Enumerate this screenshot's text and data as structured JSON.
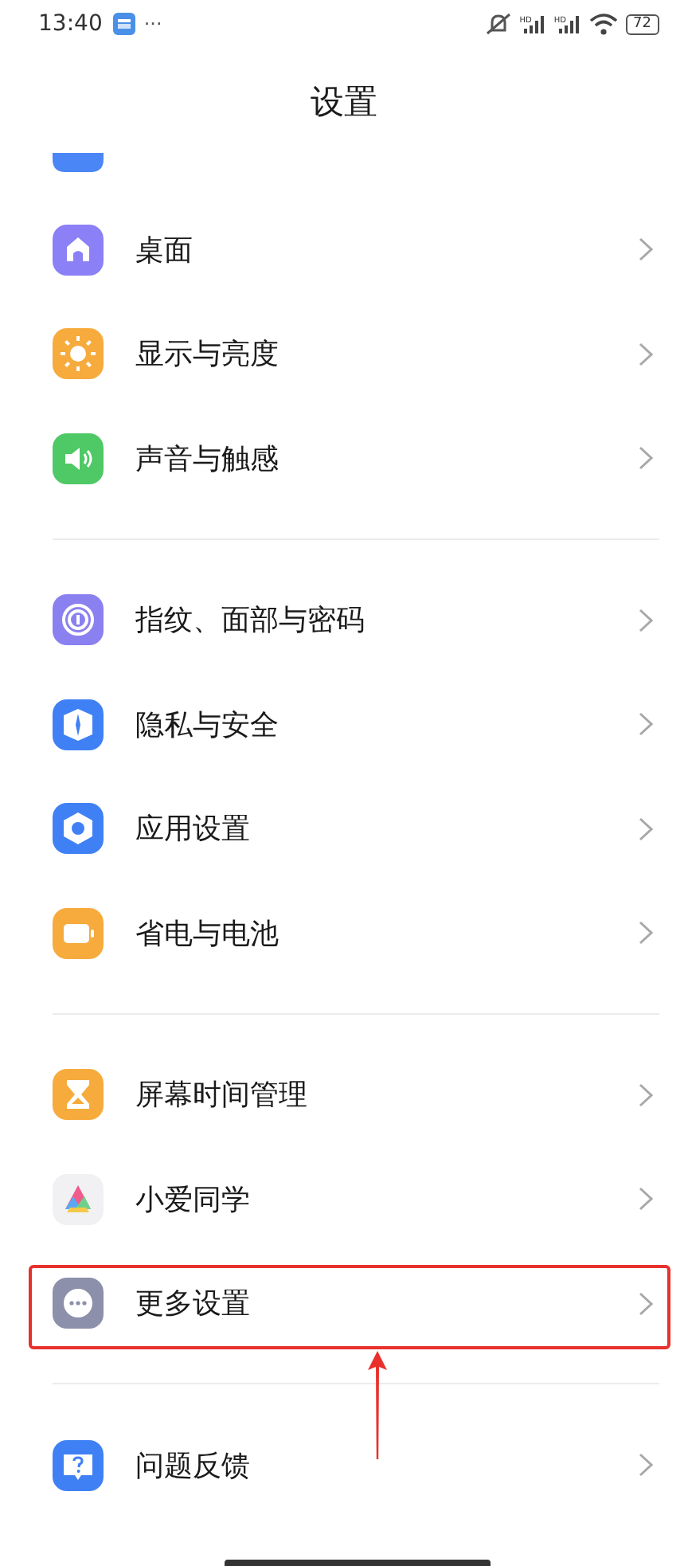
{
  "status_bar": {
    "time": "13:40",
    "more": "···",
    "signal_labels": [
      "HD",
      "HD"
    ],
    "battery": "72"
  },
  "header": {
    "title": "设置"
  },
  "groups": [
    {
      "items": [
        {
          "kind": "desktop",
          "label": "桌面",
          "highlighted": false
        },
        {
          "kind": "display",
          "label": "显示与亮度",
          "highlighted": false
        },
        {
          "kind": "sound",
          "label": "声音与触感",
          "highlighted": false
        }
      ]
    },
    {
      "items": [
        {
          "kind": "fingerprint",
          "label": "指纹、面部与密码",
          "highlighted": false
        },
        {
          "kind": "privacy",
          "label": "隐私与安全",
          "highlighted": false
        },
        {
          "kind": "apps",
          "label": "应用设置",
          "highlighted": false
        },
        {
          "kind": "battery",
          "label": "省电与电池",
          "highlighted": false
        }
      ]
    },
    {
      "items": [
        {
          "kind": "screentime",
          "label": "屏幕时间管理",
          "highlighted": false
        },
        {
          "kind": "assistant",
          "label": "小爱同学",
          "highlighted": false
        },
        {
          "kind": "more",
          "label": "更多设置",
          "highlighted": true
        }
      ]
    },
    {
      "items": [
        {
          "kind": "feedback",
          "label": "问题反馈",
          "highlighted": false
        }
      ]
    }
  ]
}
